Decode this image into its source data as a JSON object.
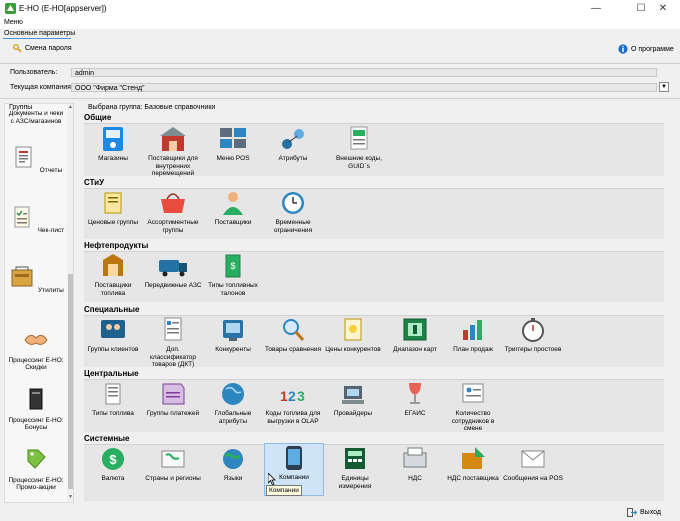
{
  "window": {
    "title": "E-HO (E-HO[appserver])",
    "controls": [
      "minimize",
      "maximize",
      "close"
    ]
  },
  "menu": {
    "label": "Меню"
  },
  "section_tab": "Основные параметры",
  "toolbar": {
    "change_password": "Смена пароля",
    "about": "О программе"
  },
  "info": {
    "user_label": "Пользователь:",
    "user_value": "admin",
    "company_label": "Текущая компания:",
    "company_value": "ООО \"Фирма \"Стенд\""
  },
  "groups": {
    "label": "Группы",
    "items": [
      {
        "label": "Документы и чеки с АЗС/магазинов",
        "icon": "documents-icon"
      },
      {
        "label": "Отчеты",
        "icon": "reports-icon"
      },
      {
        "label": "Чек-лист",
        "icon": "checklist-icon"
      },
      {
        "label": "Утилиты",
        "icon": "utilities-icon"
      },
      {
        "label": "Процессинг E-HO: Скидки",
        "icon": "discounts-icon"
      },
      {
        "label": "Процессинг E-HO: Бонусы",
        "icon": "bonuses-icon"
      },
      {
        "label": "Процессинг E-HO: Промо-акции",
        "icon": "promo-icon"
      }
    ]
  },
  "main": {
    "selected_group": "Выбрана группа: Базовые справочники",
    "sections": [
      {
        "title": "Общие",
        "items": [
          {
            "label": "Магазины",
            "icon": "shops-icon"
          },
          {
            "label": "Поставщики для внутренних перемещений",
            "icon": "internal-suppliers-icon"
          },
          {
            "label": "Меню POS",
            "icon": "pos-menu-icon"
          },
          {
            "label": "Атрибуты",
            "icon": "attributes-icon"
          },
          {
            "label": "Внешние коды, GUID`s",
            "icon": "external-codes-icon"
          }
        ]
      },
      {
        "title": "СТиУ",
        "items": [
          {
            "label": "Ценовые группы",
            "icon": "price-groups-icon"
          },
          {
            "label": "Ассортиментные группы",
            "icon": "assortment-groups-icon"
          },
          {
            "label": "Поставщики",
            "icon": "suppliers-icon"
          },
          {
            "label": "Временные ограничения",
            "icon": "time-limits-icon"
          }
        ]
      },
      {
        "title": "Нефтепродукты",
        "items": [
          {
            "label": "Поставщики топлива",
            "icon": "fuel-suppliers-icon"
          },
          {
            "label": "Передвижные АЗС",
            "icon": "mobile-station-icon"
          },
          {
            "label": "Типы топливных талонов",
            "icon": "fuel-coupons-icon"
          }
        ]
      },
      {
        "title": "Специальные",
        "items": [
          {
            "label": "Группы клиентов",
            "icon": "client-groups-icon"
          },
          {
            "label": "Доп. классификатор товаров (ДКТ)",
            "icon": "classifier-icon"
          },
          {
            "label": "Конкуренты",
            "icon": "competitors-icon"
          },
          {
            "label": "Товары сравнения",
            "icon": "comparison-goods-icon"
          },
          {
            "label": "Цены конкурентов",
            "icon": "competitor-prices-icon"
          },
          {
            "label": "Диапазон карт",
            "icon": "card-range-icon"
          },
          {
            "label": "План продаж",
            "icon": "sales-plan-icon"
          },
          {
            "label": "Триггеры простоев",
            "icon": "downtime-triggers-icon"
          }
        ]
      },
      {
        "title": "Центральные",
        "items": [
          {
            "label": "Типы топлива",
            "icon": "fuel-types-icon"
          },
          {
            "label": "Группы платежей",
            "icon": "payment-groups-icon"
          },
          {
            "label": "Глобальные атрибуты",
            "icon": "global-attributes-icon"
          },
          {
            "label": "Коды топлива для выгрузки в OLAP",
            "icon": "fuel-codes-icon"
          },
          {
            "label": "Провайдеры",
            "icon": "providers-icon"
          },
          {
            "label": "ЕГАИС",
            "icon": "egais-icon"
          },
          {
            "label": "Количество сотрудников в смене",
            "icon": "staff-count-icon"
          }
        ]
      },
      {
        "title": "Системные",
        "items": [
          {
            "label": "Валюта",
            "icon": "currency-icon"
          },
          {
            "label": "Страны и регионы",
            "icon": "countries-icon"
          },
          {
            "label": "Языки",
            "icon": "languages-icon"
          },
          {
            "label": "Компании",
            "icon": "companies-icon"
          },
          {
            "label": "Единицы измерения",
            "icon": "units-icon"
          },
          {
            "label": "НДС",
            "icon": "vat-icon"
          },
          {
            "label": "НДС поставщика",
            "icon": "supplier-vat-icon"
          },
          {
            "label": "Сообщения на POS",
            "icon": "pos-messages-icon"
          }
        ]
      }
    ]
  },
  "tooltip": "Компании",
  "footer": {
    "exit": "Выход"
  }
}
